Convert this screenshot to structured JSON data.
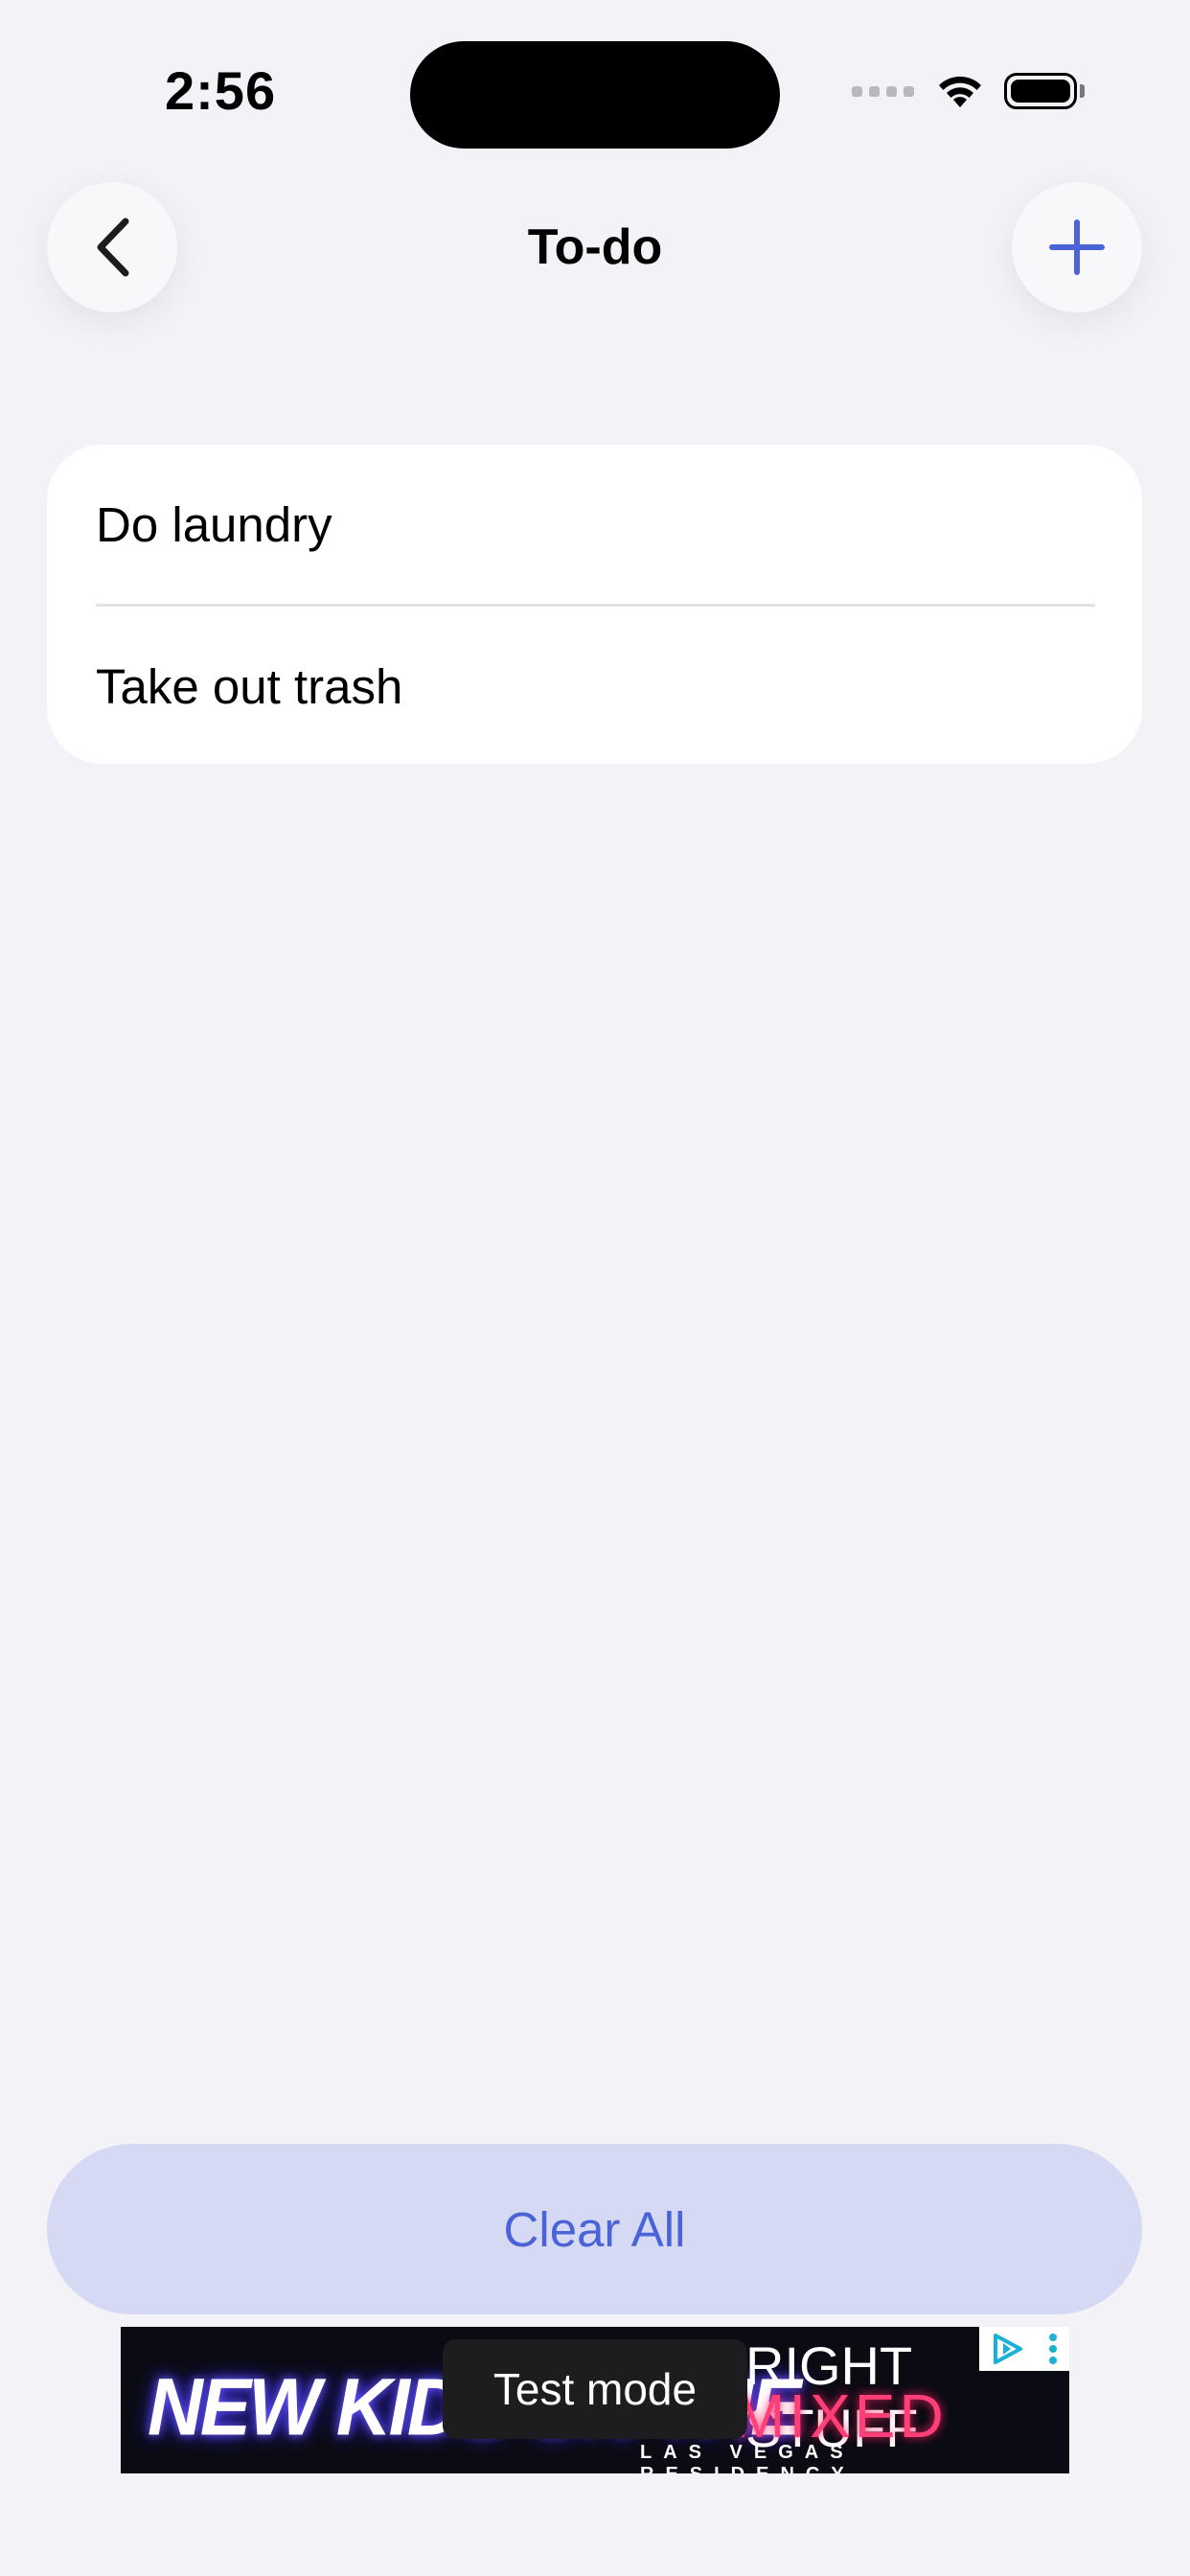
{
  "status_bar": {
    "time": "2:56"
  },
  "nav": {
    "title": "To-do",
    "back_icon": "chevron-left-icon",
    "add_icon": "plus-icon"
  },
  "todo_list": {
    "items": [
      {
        "label": "Do laundry"
      },
      {
        "label": "Take out trash"
      }
    ]
  },
  "actions": {
    "clear_all_label": "Clear All"
  },
  "ad": {
    "test_mode_label": "Test mode",
    "left_text": "NEW KIDS ON THE",
    "right_top_text": "RIGHT STUFF",
    "right_mid_text": "MIXED",
    "right_bottom_text": "LAS VEGAS RESIDENCY"
  },
  "colors": {
    "accent": "#4a63d6",
    "background": "#f2f2f7",
    "clear_button_bg": "#d5d9f3"
  }
}
